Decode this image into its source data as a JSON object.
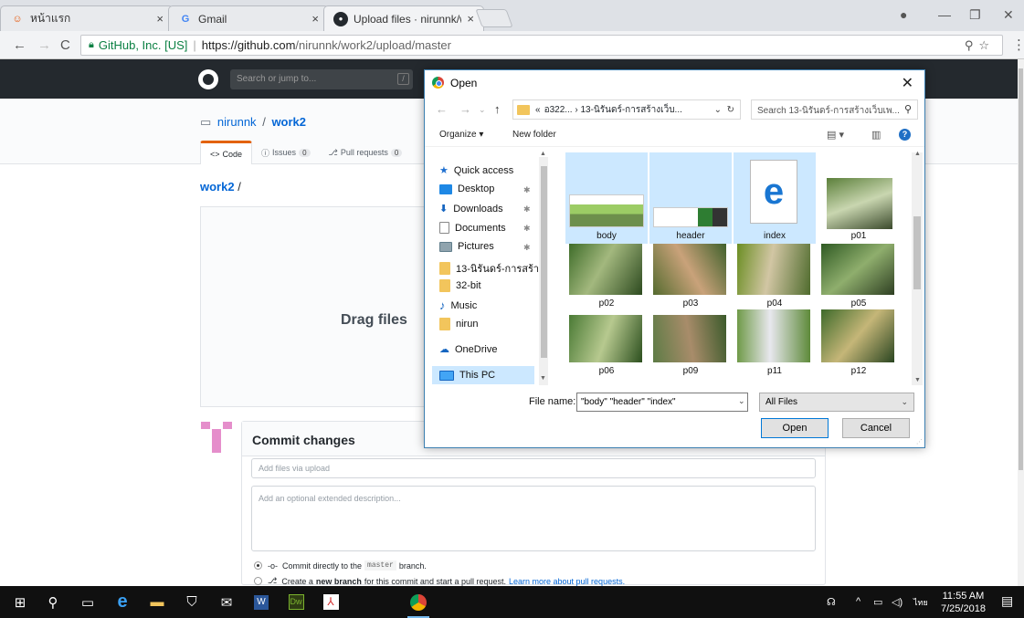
{
  "browser": {
    "tabs": [
      {
        "label": "หน้าแรก",
        "favicon": "home-face-icon"
      },
      {
        "label": "Gmail",
        "favicon": "google-icon"
      },
      {
        "label": "Upload files · nirunnk/wo",
        "favicon": "github-icon"
      }
    ],
    "tab_close": "×",
    "secure_label": "GitHub, Inc. [US]",
    "url_host": "https://github.com",
    "url_path": "/nirunnk/work2/upload/master"
  },
  "github": {
    "search_placeholder": "Search or jump to...",
    "search_hotkey": "/",
    "repo_owner": "nirunnk",
    "repo_separator": "/",
    "repo_name": "work2",
    "tabs": [
      {
        "label": "Code",
        "icon": "<>"
      },
      {
        "label": "Issues",
        "count": "0"
      },
      {
        "label": "Pull requests",
        "count": "0"
      }
    ],
    "breadcrumb_repo": "work2",
    "breadcrumb_sep": "/",
    "drop_text": "Drag files",
    "commit": {
      "title": "Commit changes",
      "summary_placeholder": "Add files via upload",
      "description_placeholder": "Add an optional extended description...",
      "opt1_pre": "Commit directly to the",
      "opt1_branch": "master",
      "opt1_post": "branch.",
      "opt2_pre": "Create a",
      "opt2_bold": "new branch",
      "opt2_mid": "for this commit and start a pull request.",
      "opt2_link": "Learn more about pull requests."
    }
  },
  "dialog": {
    "title": "Open",
    "path_prefix": "«",
    "path": "อ322... › 13-นิรันดร์-การสร้างเว็บ...",
    "search_placeholder": "Search 13-นิรันดร์-การสร้างเว็บเพ...",
    "organize_label": "Organize ▾",
    "new_folder_label": "New folder",
    "sidebar": [
      {
        "label": "Quick access",
        "icon": "star-icon",
        "color": "#1e6fd0"
      },
      {
        "label": "Desktop",
        "icon": "desktop-icon",
        "color": "#1e88e5",
        "pinned": true
      },
      {
        "label": "Downloads",
        "icon": "download-icon",
        "color": "#1565c0",
        "pinned": true
      },
      {
        "label": "Documents",
        "icon": "document-icon",
        "color": "#9e9e9e",
        "pinned": true
      },
      {
        "label": "Pictures",
        "icon": "pictures-icon",
        "color": "#90a4ae",
        "pinned": true
      },
      {
        "label": "13-นิรันดร์-การสร้า",
        "icon": "folder-icon",
        "color": "#f2c55c"
      },
      {
        "label": "32-bit",
        "icon": "folder-icon",
        "color": "#f2c55c"
      },
      {
        "label": "Music",
        "icon": "music-icon",
        "color": "#1565c0"
      },
      {
        "label": "nirun",
        "icon": "folder-icon",
        "color": "#f2c55c"
      },
      {
        "label": "OneDrive",
        "icon": "cloud-icon",
        "color": "#1565c0"
      },
      {
        "label": "This PC",
        "icon": "pc-icon",
        "color": "#42a5f5"
      }
    ],
    "files": [
      {
        "name": "body",
        "selected": true,
        "kind": "banner"
      },
      {
        "name": "header",
        "selected": true,
        "kind": "banner2"
      },
      {
        "name": "index",
        "selected": true,
        "kind": "edge"
      },
      {
        "name": "p01",
        "selected": false,
        "kind": "photo"
      },
      {
        "name": "p02",
        "selected": false,
        "kind": "photo"
      },
      {
        "name": "p03",
        "selected": false,
        "kind": "photo"
      },
      {
        "name": "p04",
        "selected": false,
        "kind": "photo"
      },
      {
        "name": "p05",
        "selected": false,
        "kind": "photo"
      },
      {
        "name": "p06",
        "selected": false,
        "kind": "photo"
      },
      {
        "name": "p09",
        "selected": false,
        "kind": "photo"
      },
      {
        "name": "p11",
        "selected": false,
        "kind": "photo"
      },
      {
        "name": "p12",
        "selected": false,
        "kind": "photo"
      }
    ],
    "filename_label": "File name:",
    "filename_value": "\"body\" \"header\" \"index\"",
    "filetype_value": "All Files",
    "open_label": "Open",
    "cancel_label": "Cancel"
  },
  "taskbar": {
    "time": "11:55 AM",
    "date": "7/25/2018",
    "lang": "ไทย"
  }
}
